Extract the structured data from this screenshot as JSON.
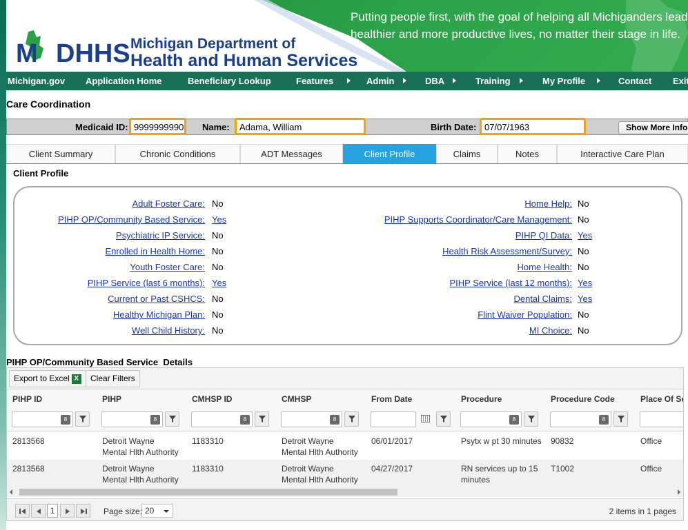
{
  "banner": {
    "logo_line1": "Michigan Department of",
    "logo_line2": "Health and Human Services",
    "logo_mark": "MDHHS",
    "tagline_line1": "Putting people first, with the goal of helping all Michiganders lead",
    "tagline_line2": "healthier and more productive lives, no matter their stage in life."
  },
  "nav": {
    "items": [
      "Michigan.gov",
      "Application Home",
      "Beneficiary Lookup",
      "Features",
      "Admin",
      "DBA",
      "Training",
      "My Profile",
      "Contact",
      "Exit"
    ]
  },
  "page": {
    "title": "Care Coordination"
  },
  "client": {
    "medicaid_label": "Medicaid ID:",
    "medicaid_value": "9999999990",
    "name_label": "Name:",
    "name_value": "Adama, William",
    "birth_label": "Birth Date:",
    "birth_value": "07/07/1963",
    "show_more": "Show More Info"
  },
  "tabs": [
    "Client Summary",
    "Chronic Conditions",
    "ADT Messages",
    "Client Profile",
    "Claims",
    "Notes",
    "Interactive Care Plan"
  ],
  "active_tab": "Client Profile",
  "profile": {
    "title": "Client Profile",
    "left": [
      {
        "label": "Adult Foster Care:",
        "value": "No"
      },
      {
        "label": "PIHP OP/Community Based Service:",
        "value": "Yes"
      },
      {
        "label": "Psychiatric IP Service:",
        "value": "No"
      },
      {
        "label": "Enrolled in Health Home:",
        "value": "No"
      },
      {
        "label": "Youth Foster Care:",
        "value": "No"
      },
      {
        "label": "PIHP Service (last 6 months):",
        "value": "Yes"
      },
      {
        "label": "Current or Past CSHCS:",
        "value": "No"
      },
      {
        "label": "Healthy Michigan Plan:",
        "value": "No"
      },
      {
        "label": "Well Child History:",
        "value": "No"
      }
    ],
    "right": [
      {
        "label": "Home Help:",
        "value": "No"
      },
      {
        "label": "PIHP Supports Coordinator/Care Management:",
        "value": "No"
      },
      {
        "label": "PIHP QI Data:",
        "value": "Yes"
      },
      {
        "label": "Health Risk Assessment/Survey:",
        "value": "No"
      },
      {
        "label": "Home Health:",
        "value": "No"
      },
      {
        "label": "PIHP Service (last 12 months):",
        "value": "Yes"
      },
      {
        "label": "Dental Claims:",
        "value": "Yes"
      },
      {
        "label": "Flint Waiver Population:",
        "value": "No"
      },
      {
        "label": "MI Choice:",
        "value": "No"
      }
    ]
  },
  "grid": {
    "title": "PIHP OP/Community Based Service  Details",
    "export_label": "Export to Excel",
    "clear_label": "Clear Filters",
    "columns": [
      "PIHP ID",
      "PIHP",
      "CMHSP ID",
      "CMHSP",
      "From Date",
      "Procedure",
      "Procedure Code",
      "Place Of Service"
    ],
    "rows": [
      {
        "pihp_id": "2813568",
        "pihp_1": "Detroit Wayne",
        "pihp_2": "Mental Hlth Authority",
        "cmhsp_id": "1183310",
        "cmhsp_1": "Detroit Wayne",
        "cmhsp_2": "Mental Hlth Authority",
        "from_date": "06/01/2017",
        "proc_1": "Psytx w pt 30 minutes",
        "proc_2": "",
        "code": "90832",
        "place": "Office"
      },
      {
        "pihp_id": "2813568",
        "pihp_1": "Detroit Wayne",
        "pihp_2": "Mental Hlth Authority",
        "cmhsp_id": "1183310",
        "cmhsp_1": "Detroit Wayne",
        "cmhsp_2": "Mental Hlth Authority",
        "from_date": "04/27/2017",
        "proc_1": "RN services up to 15",
        "proc_2": "minutes",
        "code": "T1002",
        "place": "Office"
      }
    ],
    "pager": {
      "current_page": "1",
      "page_size_label": "Page size:",
      "page_size": "20",
      "info": "2 items in 1 pages"
    }
  }
}
